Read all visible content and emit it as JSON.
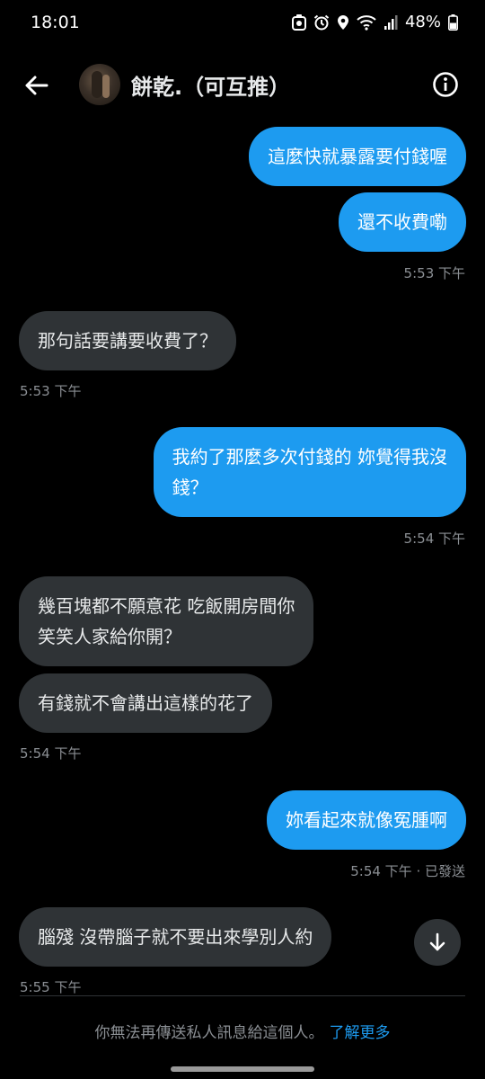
{
  "status_bar": {
    "time": "18:01",
    "battery": "48%",
    "icons": [
      "app-icon",
      "alarm-icon",
      "location-icon",
      "wifi-icon",
      "signal-icon",
      "battery-icon"
    ]
  },
  "header": {
    "contact_name": "餅乾.（可互推）",
    "back_icon": "arrow-left-icon",
    "info_icon": "info-icon"
  },
  "messages": [
    {
      "direction": "out",
      "lines": [
        "這麼快就暴露要付錢喔"
      ]
    },
    {
      "direction": "out",
      "lines": [
        "還不收費嘞"
      ]
    },
    {
      "direction": "out",
      "timestamp": "5:53 下午"
    },
    {
      "direction": "in",
      "lines": [
        "那句話要講要收費了？"
      ]
    },
    {
      "direction": "in",
      "timestamp": "5:53 下午"
    },
    {
      "direction": "out",
      "lines": [
        "我約了那麼多次付錢的 妳覺得我沒",
        "錢？"
      ]
    },
    {
      "direction": "out",
      "timestamp": "5:54 下午"
    },
    {
      "direction": "in",
      "lines": [
        "幾百塊都不願意花  吃飯開房間你",
        "笑笑人家給你開？"
      ]
    },
    {
      "direction": "in",
      "lines": [
        "有錢就不會講出這樣的花了"
      ]
    },
    {
      "direction": "in",
      "timestamp": "5:54 下午"
    },
    {
      "direction": "out",
      "lines": [
        "妳看起來就像冤腫啊"
      ]
    },
    {
      "direction": "out",
      "timestamp": "5:54 下午 · 已發送"
    },
    {
      "direction": "in",
      "lines": [
        "腦殘 沒帶腦子就不要出來學別人約"
      ]
    },
    {
      "direction": "in",
      "timestamp": "5:55 下午"
    }
  ],
  "footer": {
    "notice": "你無法再傳送私人訊息給這個人。",
    "link": "了解更多"
  },
  "colors": {
    "background": "#000000",
    "outgoing_bubble": "#1d9bf0",
    "incoming_bubble": "#2f3336",
    "timestamp": "#8b8f94",
    "link": "#1d9bf0"
  }
}
